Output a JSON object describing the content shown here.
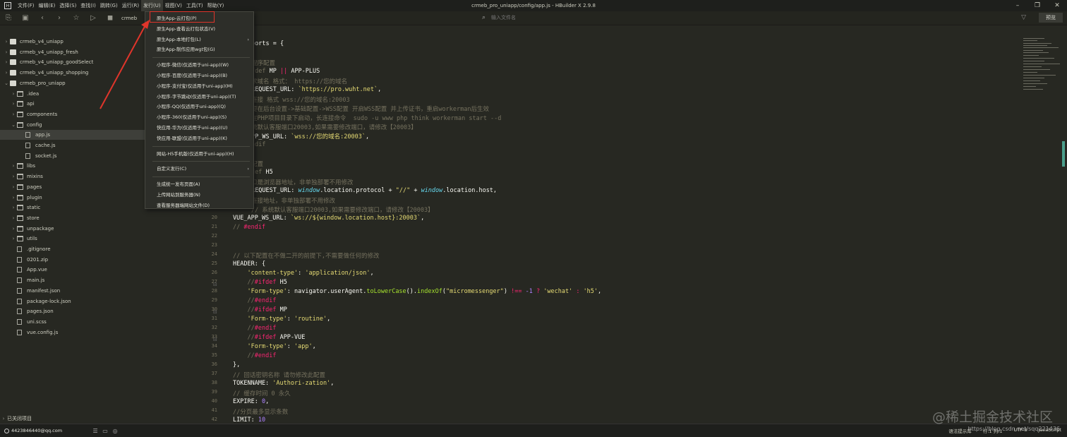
{
  "window": {
    "title": "crmeb_pro_uniapp/config/app.js - HBuilder X 2.9.8",
    "menu": [
      "文件(F)",
      "编辑(E)",
      "选择(S)",
      "查找(I)",
      "跳转(G)",
      "运行(R)",
      "发行(U)",
      "视图(V)",
      "工具(T)",
      "帮助(Y)"
    ],
    "controls": [
      "–",
      "❐",
      "✕"
    ]
  },
  "toolbar": {
    "crumb": "crmeb",
    "search_placeholder": "输入文件名",
    "preview_label": "预览"
  },
  "sidebar": {
    "items": [
      {
        "label": "crmeb_v4_uniapp",
        "type": "proj",
        "arrow": "›"
      },
      {
        "label": "crmeb_v4_uniapp_fresh",
        "type": "proj",
        "arrow": "›"
      },
      {
        "label": "crmeb_v4_uniapp_goodSelect",
        "type": "proj",
        "arrow": "›"
      },
      {
        "label": "crmeb_v4_uniapp_shopping",
        "type": "proj",
        "arrow": "›"
      },
      {
        "label": "crmeb_pro_uniapp",
        "type": "proj",
        "arrow": "⌄"
      },
      {
        "label": ".idea",
        "type": "folder",
        "arrow": "›"
      },
      {
        "label": "api",
        "type": "folder",
        "arrow": "›"
      },
      {
        "label": "components",
        "type": "folder",
        "arrow": "›"
      },
      {
        "label": "config",
        "type": "folder",
        "arrow": "⌄"
      },
      {
        "label": "app.js",
        "type": "file",
        "arrow": "",
        "selected": true
      },
      {
        "label": "cache.js",
        "type": "file",
        "arrow": ""
      },
      {
        "label": "socket.js",
        "type": "file",
        "arrow": ""
      },
      {
        "label": "libs",
        "type": "folder",
        "arrow": "›"
      },
      {
        "label": "mixins",
        "type": "folder",
        "arrow": "›"
      },
      {
        "label": "pages",
        "type": "folder",
        "arrow": "›"
      },
      {
        "label": "plugin",
        "type": "folder",
        "arrow": "›"
      },
      {
        "label": "static",
        "type": "folder",
        "arrow": "›"
      },
      {
        "label": "store",
        "type": "folder",
        "arrow": "›"
      },
      {
        "label": "unpackage",
        "type": "folder",
        "arrow": "›"
      },
      {
        "label": "utils",
        "type": "folder",
        "arrow": "›"
      },
      {
        "label": ".gitignore",
        "type": "file",
        "arrow": ""
      },
      {
        "label": "0201.zip",
        "type": "file",
        "arrow": ""
      },
      {
        "label": "App.vue",
        "type": "file",
        "arrow": ""
      },
      {
        "label": "main.js",
        "type": "file",
        "arrow": ""
      },
      {
        "label": "manifest.json",
        "type": "file",
        "arrow": ""
      },
      {
        "label": "package-lock.json",
        "type": "file",
        "arrow": ""
      },
      {
        "label": "pages.json",
        "type": "file",
        "arrow": ""
      },
      {
        "label": "uni.scss",
        "type": "file",
        "arrow": ""
      },
      {
        "label": "vue.config.js",
        "type": "file",
        "arrow": ""
      }
    ],
    "closed_projects": "已关闭项目"
  },
  "dropdown": {
    "groups": [
      [
        {
          "label": "原生App-云打包(P)"
        },
        {
          "label": "原生App-查看云打包状态(V)"
        },
        {
          "label": "原生App-本地打包(L)",
          "sub": true
        },
        {
          "label": "原生App-制作应用wgt包(G)"
        }
      ],
      [
        {
          "label": "小程序-微信(仅适用于uni-app)(W)"
        },
        {
          "label": "小程序-百度(仅适用于uni-app)(B)"
        },
        {
          "label": "小程序-支付宝(仅适用于uni-app)(M)"
        },
        {
          "label": "小程序-字节跳动(仅适用于uni-app)(T)"
        },
        {
          "label": "小程序-QQ(仅适用于uni-app)(Q)"
        },
        {
          "label": "小程序-360(仅适用于uni-app)(S)"
        },
        {
          "label": "快应用-华为(仅适用于uni-app)(U)"
        },
        {
          "label": "快应用-联盟(仅适用于uni-app)(K)"
        }
      ],
      [
        {
          "label": "网站-H5手机版(仅适用于uni-app)(H)"
        }
      ],
      [
        {
          "label": "自定义发行(C)",
          "sub": true
        }
      ],
      [
        {
          "label": "生成统一发布页面(A)"
        },
        {
          "label": "上传网站到服务器(N)"
        },
        {
          "label": "查看服务器端网站文件(D)"
        }
      ]
    ]
  },
  "code": {
    "lines": [
      {
        "n": "",
        "t": [
          [
            "w",
            "ports = {"
          ]
        ]
      },
      {
        "n": "",
        "t": []
      },
      {
        "n": "",
        "t": [
          [
            "c",
            "程序配置"
          ]
        ]
      },
      {
        "n": "",
        "t": [
          [
            "c",
            "fdef "
          ],
          [
            "w",
            "MP "
          ],
          [
            "k",
            "||"
          ],
          [
            "w",
            " APP-PLUS"
          ]
        ]
      },
      {
        "n": "",
        "t": [
          [
            "c",
            "求域名 格式： https://您的域名"
          ]
        ]
      },
      {
        "n": "",
        "t": [
          [
            "w",
            "REQUEST_URL: "
          ],
          [
            "s",
            "`https://pro.wuht.net`"
          ],
          [
            "w",
            ","
          ]
        ]
      },
      {
        "n": "",
        "t": [
          [
            "c",
            "连接 格式 wss://您的域名:20003"
          ]
        ]
      },
      {
        "n": "",
        "t": [
          [
            "c",
            "要在后台设置->基础配置->WSS配置 开启WSS配置 并上传证书，重启workerman后生效"
          ]
        ]
      },
      {
        "n": "",
        "t": [
          [
            "c",
            "在PHP项目目录下启动，长连接命令  sudo -u www php think workerman start --d"
          ]
        ]
      },
      {
        "n": "",
        "t": [
          [
            "c",
            "统默认客服端口20003,如果需要修改端口，请修改【20003】"
          ]
        ]
      },
      {
        "n": "",
        "t": [
          [
            "w",
            "PP_WS_URL: "
          ],
          [
            "s",
            "`wss://您的域名:20003`"
          ],
          [
            "w",
            ","
          ]
        ]
      },
      {
        "n": "",
        "t": [
          [
            "c",
            "ndif"
          ]
        ]
      },
      {
        "n": "",
        "t": []
      },
      {
        "n": "",
        "t": [
          [
            "c",
            "配置"
          ]
        ]
      },
      {
        "n": "",
        "t": [
          [
            "c",
            "def "
          ],
          [
            "w",
            "H5"
          ]
        ]
      },
      {
        "n": "",
        "t": [
          [
            "c",
            "口是浏览器地址，非单独部署不用修改"
          ]
        ]
      },
      {
        "n": "",
        "t": [
          [
            "w",
            "REQUEST_URL: "
          ],
          [
            "v",
            "window"
          ],
          [
            "w",
            ".location.protocol + "
          ],
          [
            "s",
            "\"//\""
          ],
          [
            "w",
            " + "
          ],
          [
            "v",
            "window"
          ],
          [
            "w",
            ".location.host,"
          ]
        ]
      },
      {
        "n": "",
        "t": [
          [
            "c",
            "连接地址，非单独部署不用修改"
          ]
        ]
      },
      {
        "n": "",
        "t": [
          [
            "c",
            "// 系统默认客服端口20003,如果需要修改端口，请修改【20003】"
          ]
        ]
      },
      {
        "n": "20",
        "t": [
          [
            "w",
            "VUE_APP_WS_URL: "
          ],
          [
            "s",
            "`ws://${window.location.host}:20003`"
          ],
          [
            "w",
            ","
          ]
        ]
      },
      {
        "n": "21",
        "t": [
          [
            "c",
            "// "
          ],
          [
            "k",
            "#endif"
          ]
        ]
      },
      {
        "n": "22",
        "t": []
      },
      {
        "n": "23",
        "t": []
      },
      {
        "n": "24",
        "t": [
          [
            "c",
            "// 以下配置在不做二开的前提下,不需要做任何的修改"
          ]
        ]
      },
      {
        "n": "25",
        "t": [
          [
            "w",
            "HEADER: {"
          ]
        ]
      },
      {
        "n": "26",
        "t": [
          [
            "w",
            "    "
          ],
          [
            "s",
            "'content-type'"
          ],
          [
            "w",
            ": "
          ],
          [
            "s",
            "'application/json'"
          ],
          [
            "w",
            ","
          ]
        ]
      },
      {
        "n": "27",
        "t": [
          [
            "w",
            "    "
          ],
          [
            "c",
            "//"
          ],
          [
            "k",
            "#ifdef"
          ],
          [
            "w",
            " H5"
          ]
        ]
      },
      {
        "n": "28",
        "t": [
          [
            "w",
            "    "
          ],
          [
            "s",
            "'Form-type'"
          ],
          [
            "w",
            ": navigator.userAgent."
          ],
          [
            "f",
            "toLowerCase"
          ],
          [
            "w",
            "()."
          ],
          [
            "f",
            "indexOf"
          ],
          [
            "w",
            "("
          ],
          [
            "s",
            "\"micromessenger\""
          ],
          [
            "w",
            ") "
          ],
          [
            "k",
            "!=="
          ],
          [
            "w",
            " "
          ],
          [
            "n",
            "-1"
          ],
          [
            "w",
            " "
          ],
          [
            "k",
            "?"
          ],
          [
            "w",
            " "
          ],
          [
            "s",
            "'wechat'"
          ],
          [
            "w",
            " "
          ],
          [
            "k",
            ":"
          ],
          [
            "w",
            " "
          ],
          [
            "s",
            "'h5'"
          ],
          [
            "w",
            ","
          ]
        ]
      },
      {
        "n": "29",
        "t": [
          [
            "w",
            "    "
          ],
          [
            "c",
            "//"
          ],
          [
            "k",
            "#endif"
          ]
        ]
      },
      {
        "n": "30",
        "t": [
          [
            "w",
            "    "
          ],
          [
            "c",
            "//"
          ],
          [
            "k",
            "#ifdef"
          ],
          [
            "w",
            " MP"
          ]
        ]
      },
      {
        "n": "31",
        "t": [
          [
            "w",
            "    "
          ],
          [
            "s",
            "'Form-type'"
          ],
          [
            "w",
            ": "
          ],
          [
            "s",
            "'routine'"
          ],
          [
            "w",
            ","
          ]
        ]
      },
      {
        "n": "32",
        "t": [
          [
            "w",
            "    "
          ],
          [
            "c",
            "//"
          ],
          [
            "k",
            "#endif"
          ]
        ]
      },
      {
        "n": "33",
        "t": [
          [
            "w",
            "    "
          ],
          [
            "c",
            "//"
          ],
          [
            "k",
            "#ifdef"
          ],
          [
            "w",
            " APP-VUE"
          ]
        ]
      },
      {
        "n": "34",
        "t": [
          [
            "w",
            "    "
          ],
          [
            "s",
            "'Form-type'"
          ],
          [
            "w",
            ": "
          ],
          [
            "s",
            "'app'"
          ],
          [
            "w",
            ","
          ]
        ]
      },
      {
        "n": "35",
        "t": [
          [
            "w",
            "    "
          ],
          [
            "c",
            "//"
          ],
          [
            "k",
            "#endif"
          ]
        ]
      },
      {
        "n": "36",
        "t": [
          [
            "w",
            "},"
          ]
        ]
      },
      {
        "n": "37",
        "t": [
          [
            "c",
            "// 回话密钥名称 请勿修改此配置"
          ]
        ]
      },
      {
        "n": "38",
        "t": [
          [
            "w",
            "TOKENNAME: "
          ],
          [
            "s",
            "'Authori-zation'"
          ],
          [
            "w",
            ","
          ]
        ]
      },
      {
        "n": "39",
        "t": [
          [
            "c",
            "// 缓存时间 0 永久"
          ]
        ]
      },
      {
        "n": "40",
        "t": [
          [
            "w",
            "EXPIRE: "
          ],
          [
            "n",
            "0"
          ],
          [
            "w",
            ","
          ]
        ]
      },
      {
        "n": "41",
        "t": [
          [
            "c",
            "//分页最多显示条数"
          ]
        ]
      },
      {
        "n": "42",
        "t": [
          [
            "w",
            "LIMIT: "
          ],
          [
            "n",
            "10"
          ]
        ]
      }
    ]
  },
  "statusbar": {
    "user": "4423846440@qq.com",
    "right": [
      "语法提示库",
      "行:1  列:1",
      "UTF-8",
      "JavaScript"
    ]
  },
  "watermark": {
    "text": "@稀土掘金技术社区",
    "url": "https://blog.csdn.net/sqq221436"
  },
  "colors": {
    "highlight_box": "#e0352b",
    "scroll_thumb": "#4b9f8c"
  }
}
